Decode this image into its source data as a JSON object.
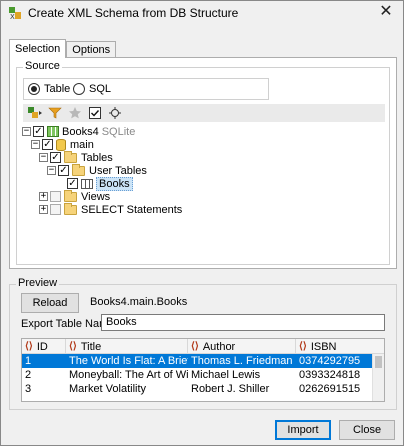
{
  "window": {
    "title": "Create XML Schema from DB Structure",
    "close_glyph": "✕"
  },
  "tabs": [
    {
      "label": "Selection"
    },
    {
      "label": "Options"
    }
  ],
  "source": {
    "group_label": "Source",
    "radio_table": "Table",
    "radio_sql": "SQL",
    "selected": "Table"
  },
  "toolbar": {
    "icons": [
      "add-filter-icon",
      "filter-icon",
      "star-icon",
      "checkmark-icon",
      "locate-icon"
    ]
  },
  "tree": {
    "root_label": "Books4",
    "root_suffix": "SQLite",
    "schema_label": "main",
    "tables_label": "Tables",
    "user_tables_label": "User Tables",
    "books_label": "Books",
    "views_label": "Views",
    "select_label": "SELECT Statements"
  },
  "preview": {
    "group_label": "Preview",
    "reload_label": "Reload",
    "table_path": "Books4.main.Books",
    "export_name_label": "Export Table Name:",
    "export_name_value": "Books"
  },
  "grid": {
    "columns": [
      "ID",
      "Title",
      "Author",
      "ISBN"
    ],
    "rows": [
      [
        "1",
        "The World Is Flat: A Brief...",
        "Thomas L. Friedman",
        "0374292795"
      ],
      [
        "2",
        "Moneyball: The Art of Wi...",
        "Michael Lewis",
        "0393324818"
      ],
      [
        "3",
        "Market Volatility",
        "Robert J. Shiller",
        "0262691515"
      ]
    ]
  },
  "buttons": {
    "import_label": "Import",
    "close_label": "Close"
  }
}
